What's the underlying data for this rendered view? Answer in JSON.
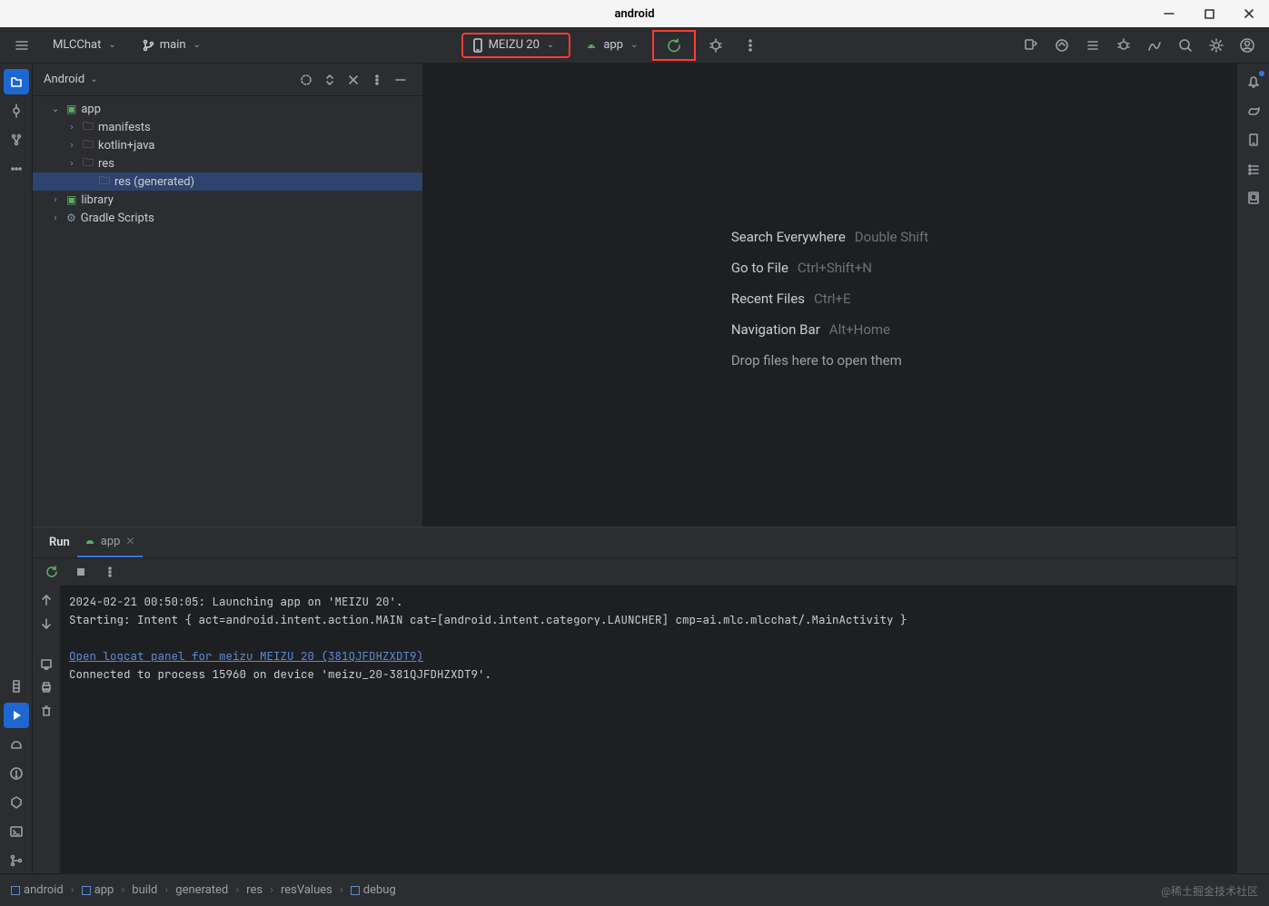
{
  "window": {
    "title": "android"
  },
  "toolbar": {
    "module": "MLCChat",
    "branch": "main",
    "device": "MEIZU 20",
    "run_config": "app"
  },
  "project": {
    "view": "Android",
    "tree": {
      "app": "app",
      "manifests": "manifests",
      "kotlin_java": "kotlin+java",
      "res": "res",
      "res_gen": "res (generated)",
      "library": "library",
      "gradle_scripts": "Gradle Scripts"
    }
  },
  "empty_state": {
    "search": {
      "label": "Search Everywhere",
      "shortcut": "Double Shift"
    },
    "goto_file": {
      "label": "Go to File",
      "shortcut": "Ctrl+Shift+N"
    },
    "recent": {
      "label": "Recent Files",
      "shortcut": "Ctrl+E"
    },
    "navbar": {
      "label": "Navigation Bar",
      "shortcut": "Alt+Home"
    },
    "drop": "Drop files here to open them"
  },
  "run_panel": {
    "title": "Run",
    "tab": "app",
    "console": {
      "line1": "2024-02-21 00:50:05: Launching app on 'MEIZU 20'.",
      "line2": "Starting: Intent { act=android.intent.action.MAIN cat=[android.intent.category.LAUNCHER] cmp=ai.mlc.mlcchat/.MainActivity }",
      "link": "Open logcat panel for meizu MEIZU 20 (381QJFDHZXDT9)",
      "line3": "Connected to process 15960 on device 'meizu_20-381QJFDHZXDT9'."
    }
  },
  "breadcrumb": {
    "items": [
      "android",
      "app",
      "build",
      "generated",
      "res",
      "resValues",
      "debug"
    ]
  },
  "watermark": "@稀土掘金技术社区"
}
